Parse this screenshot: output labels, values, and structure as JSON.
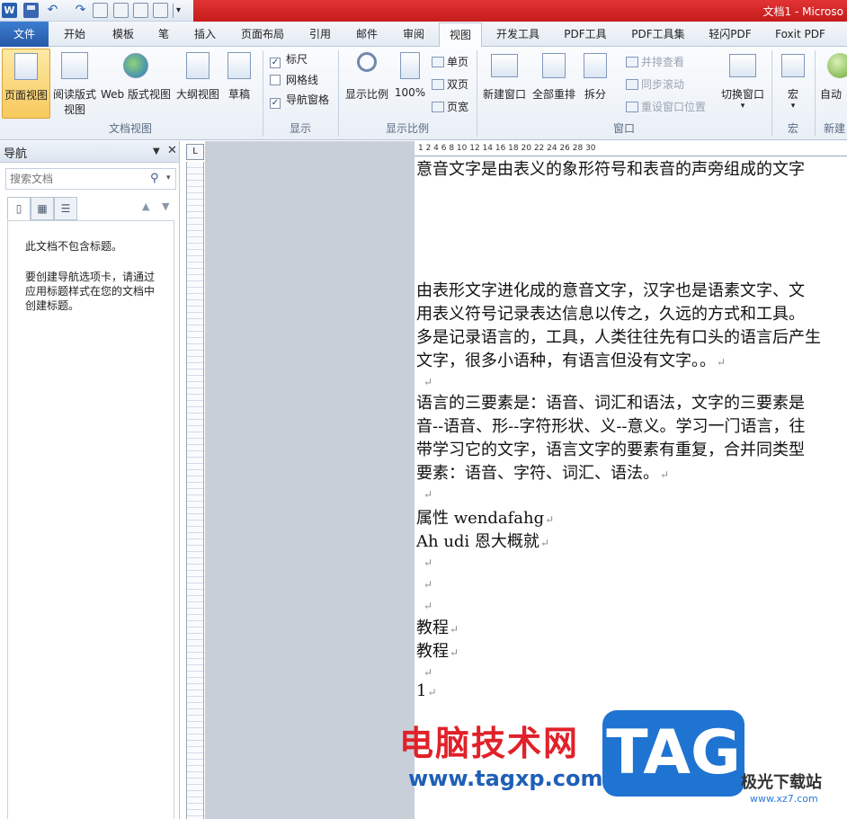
{
  "titlebar": {
    "doc_title": "文档1 - Microso",
    "word_logo": "W"
  },
  "tabs": [
    "文件",
    "开始",
    "模板",
    "笔",
    "插入",
    "页面布局",
    "引用",
    "邮件",
    "审阅",
    "视图",
    "开发工具",
    "PDF工具",
    "PDF工具集",
    "轻闪PDF",
    "Foxit PDF"
  ],
  "ribbon": {
    "doc_views": {
      "label": "文档视图",
      "buttons": [
        "页面视图",
        "阅读版式",
        "视图",
        "Web 版式视图",
        "大纲视图",
        "草稿"
      ]
    },
    "show": {
      "label": "显示",
      "checks": [
        {
          "label": "标尺",
          "checked": true
        },
        {
          "label": "网格线",
          "checked": false
        },
        {
          "label": "导航窗格",
          "checked": true
        }
      ]
    },
    "zoom": {
      "label": "显示比例",
      "buttons": [
        "显示比例",
        "100%",
        "单页",
        "双页",
        "页宽"
      ]
    },
    "window": {
      "label": "窗口",
      "buttons": [
        "新建窗口",
        "全部重排",
        "拆分",
        "并排查看",
        "同步滚动",
        "重设窗口位置",
        "切换窗口"
      ]
    },
    "macro": {
      "label": "宏",
      "button": "宏"
    },
    "new_group": {
      "label": "新建",
      "button": "自动"
    }
  },
  "nav": {
    "title": "导航",
    "search_placeholder": "搜索文档",
    "msg1": "此文档不包含标题。",
    "msg2": "要创建导航选项卡，请通过应用标题样式在您的文档中创建标题。"
  },
  "ruler": {
    "marks": "1  2  4  6  8  10  12  14  16  18  20  22  24  26  28  30"
  },
  "document": {
    "lines": [
      "意音文字是由表义的象形符号和表音的声旁组成的文字",
      "由表形文字进化成的意音文字，汉字也是语素文字、文",
      "用表义符号记录表达信息以传之，久远的方式和工具。",
      "多是记录语言的，工具，人类往往先有口头的语言后产生",
      "文字，很多小语种，有语言但没有文字。。",
      "",
      "语言的三要素是：语音、词汇和语法，文字的三要素是",
      "音--语音、形--字符形状、义--意义。学习一门语言，往",
      "带学习它的文字，语言文字的要素有重复，合并同类型",
      "要素：语音、字符、词汇、语法。",
      "",
      "属性  wendafahg",
      "Ah udi  恩大概就",
      "",
      "",
      "",
      "教程",
      "教程",
      "",
      "1"
    ]
  },
  "watermark": {
    "site_cn": "电脑技术网",
    "url": "www.tagxp.com",
    "tag": "TAG",
    "jg": "极光下载站",
    "jg_url": "www.xz7.com"
  },
  "colors": {
    "accent_blue": "#2659a8",
    "title_red": "#d22a2a",
    "active_button": "#f8c95c"
  }
}
